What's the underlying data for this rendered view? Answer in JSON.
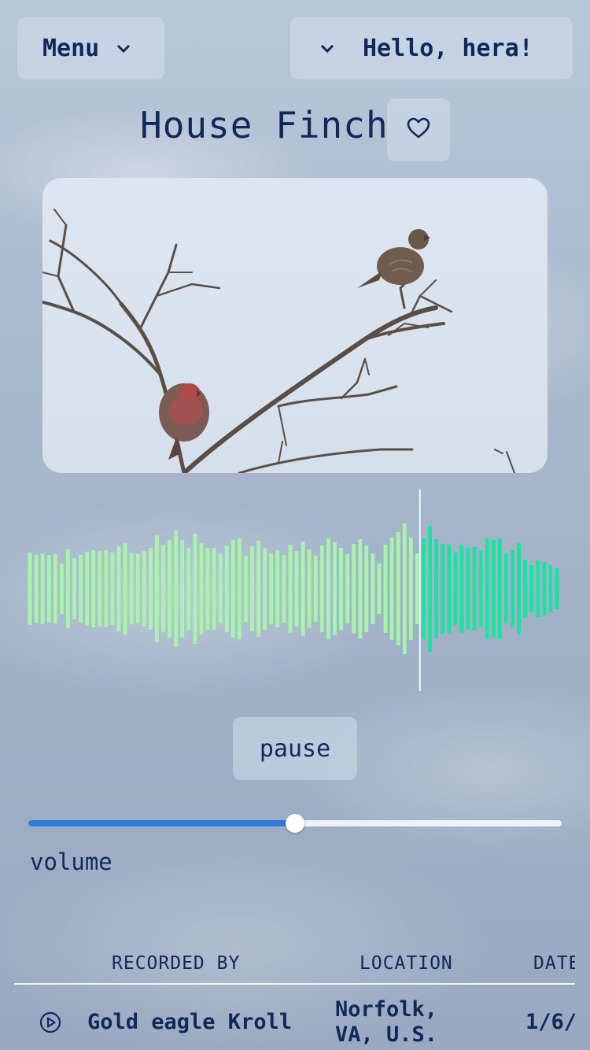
{
  "header": {
    "menu_label": "Menu",
    "greeting": "Hello, hera!",
    "menu_chevron_icon": "chevron-down-icon",
    "greeting_chevron_icon": "chevron-down-icon"
  },
  "bird": {
    "name": "House Finch",
    "favorite_icon": "heart-outline-icon"
  },
  "player": {
    "pause_label": "pause",
    "volume_label": "volume",
    "volume_level_percent": 50,
    "playback_progress": 0.74
  },
  "table": {
    "columns": [
      "RECORDED BY",
      "LOCATION",
      "DATE"
    ],
    "rows": [
      {
        "recorded_by": "Gold eagle Kroll",
        "location": "Norfolk, VA, U.S.",
        "date": "1/6/"
      }
    ]
  },
  "colors": {
    "text": "#10285a",
    "wave_played": "#a6f5a8",
    "wave_unplayed": "#19e39f",
    "slider_fill": "#2f7bd6"
  }
}
